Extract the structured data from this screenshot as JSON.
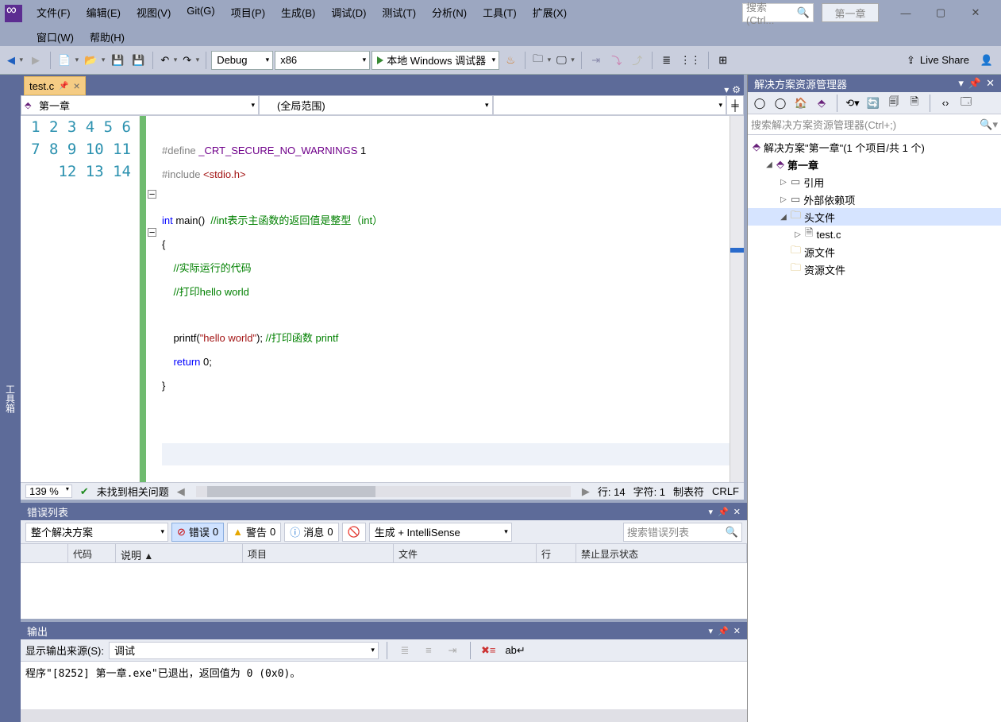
{
  "menu": {
    "file": "文件(F)",
    "edit": "编辑(E)",
    "view": "视图(V)",
    "git": "Git(G)",
    "project": "项目(P)",
    "build": "生成(B)",
    "debug": "调试(D)",
    "test": "测试(T)",
    "analyze": "分析(N)",
    "tools": "工具(T)",
    "extensions": "扩展(X)",
    "window": "窗口(W)",
    "help": "帮助(H)"
  },
  "search": {
    "placeholder": "搜索 (Ctrl...",
    "icon": "🔍"
  },
  "title_chapter": "第一章",
  "toolbar": {
    "config": "Debug",
    "platform": "x86",
    "run": "本地 Windows 调试器",
    "live": "Live Share"
  },
  "side_tab": "工具箱",
  "doc": {
    "tab": "test.c"
  },
  "nav": {
    "scope": "第一章",
    "global": "(全局范围)"
  },
  "code": {
    "lines": [
      1,
      2,
      3,
      4,
      5,
      6,
      7,
      8,
      9,
      10,
      11,
      12,
      13,
      14
    ],
    "l1a": "#define ",
    "l1b": "_CRT_SECURE_NO_WARNINGS",
    "l1c": " 1",
    "l2a": "#include ",
    "l2b": "<stdio.h>",
    "l4a": "int",
    "l4b": " main()  ",
    "l4c": "//int表示主函数的返回值是整型（int）",
    "l5": "{",
    "l6": "    //实际运行的代码",
    "l7": "    //打印hello world",
    "l9a": "    printf(",
    "l9b": "\"hello world\"",
    "l9c": "); ",
    "l9d": "//打印函数 printf",
    "l10a": "    return",
    "l10b": " 0;",
    "l11": "}"
  },
  "status": {
    "zoom": "139 %",
    "ok": "✔",
    "issues": "未找到相关问题",
    "line": "行: 14",
    "col": "字符: 1",
    "tabs": "制表符",
    "eol": "CRLF"
  },
  "errlist": {
    "title": "错误列表",
    "scope": "整个解决方案",
    "errors_label": "错误",
    "errors_n": "0",
    "warnings_label": "警告",
    "warnings_n": "0",
    "messages_label": "消息",
    "messages_n": "0",
    "source": "生成 + IntelliSense",
    "search": "搜索错误列表",
    "cols": {
      "code": "代码",
      "desc": "说明",
      "project": "项目",
      "file": "文件",
      "line": "行",
      "suppress": "禁止显示状态"
    }
  },
  "output": {
    "title": "输出",
    "from_label": "显示输出来源(S):",
    "from": "调试",
    "text": "程序\"[8252] 第一章.exe\"已退出，返回值为 0 (0x0)。"
  },
  "solution": {
    "panel_title": "解决方案资源管理器",
    "search": "搜索解决方案资源管理器(Ctrl+;)",
    "root": "解决方案\"第一章\"(1 个项目/共 1 个)",
    "project": "第一章",
    "refs": "引用",
    "ext": "外部依赖项",
    "headers": "头文件",
    "file": "test.c",
    "src": "源文件",
    "res": "资源文件"
  }
}
